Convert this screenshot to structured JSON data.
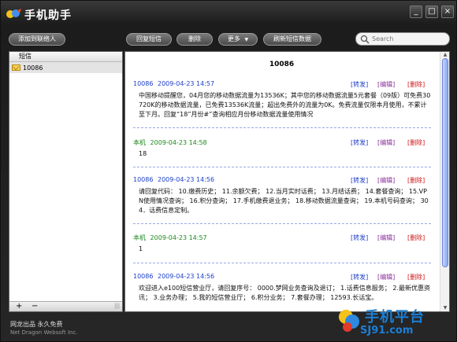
{
  "app": {
    "title": "手机助手",
    "window_buttons": [
      "_",
      "□",
      "×"
    ]
  },
  "toolbar": {
    "add_contact": "添加到联络人",
    "reply": "回复短信",
    "delete": "删除",
    "more": "更多",
    "refresh": "刷新短信数据",
    "search_placeholder": "Search"
  },
  "sidebar": {
    "header": "短信",
    "items": [
      {
        "label": "10086",
        "icon": "envelope-icon"
      }
    ],
    "footer": {
      "add": "+",
      "remove": "−",
      "grip": "|||"
    }
  },
  "conversation": {
    "title": "10086",
    "actions": {
      "forward": "[转发]",
      "edit": "[编辑]",
      "delete": "[删除]"
    },
    "messages": [
      {
        "sender": "10086",
        "time": "2009-04-23 14:57",
        "is_me": false,
        "body": "中国移动提醒您，04月您的移动数据流量为13536K；其中您的移动数据流量5元套餐（09版）可免费30720K的移动数据流量，已免费13536K流量；超出免费外的流量为0K。免费流量仅限本月使用，不累计至下月。回复“18”月份#”查询相应月份移动数据流量使用情况"
      },
      {
        "sender": "本机",
        "time": "2009-04-23 14:58",
        "is_me": true,
        "body": "18"
      },
      {
        "sender": "10086",
        "time": "2009-04-23 14:56",
        "is_me": false,
        "body": "请回复代码： 10.缴费历史； 11.余额欠费； 12.当月实时话费； 13.月结话费； 14.套餐查询； 15.VPN使用情况查询； 16.积分查询； 17.手机缴费退业务； 18.移动数据流量查询； 19.本机号码查询； 304．话费信息定制。"
      },
      {
        "sender": "本机",
        "time": "2009-04-23 14:57",
        "is_me": true,
        "body": "1"
      },
      {
        "sender": "10086",
        "time": "2009-04-23 14:56",
        "is_me": false,
        "body": "欢迎进入e100短信营业厅，请回复序号： 0000.梦网业务查询及退订； 1.话费信息服务； 2.最新优惠资讯； 3.业务办理； 5.我的短信营业厅； 6.积分业务； 7.套餐办理； 12593.长话宝。"
      }
    ]
  },
  "footer": {
    "line1": "网龙出品 永久免费",
    "line2": "Net Dragon Websoft Inc."
  },
  "watermark": {
    "title": "手机平台",
    "url": "SJ91.com"
  },
  "colors": {
    "accent_blue": "#1b3ec9",
    "me_green": "#1a8a1a",
    "delete_red": "#d01a1a",
    "edit_purple": "#8a2f9a"
  }
}
